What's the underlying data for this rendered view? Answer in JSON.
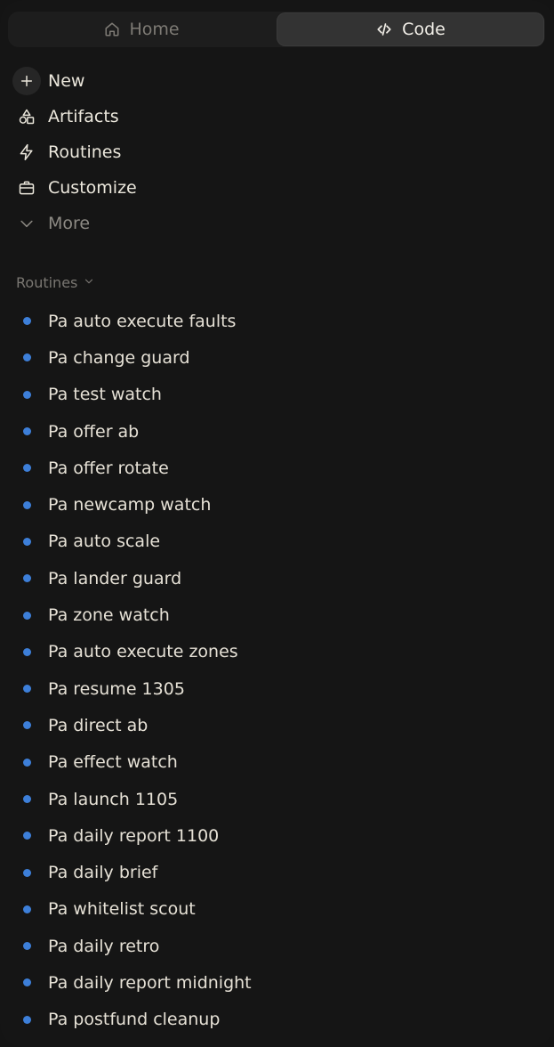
{
  "tabs": [
    {
      "label": "Home",
      "icon": "home-icon",
      "active": false
    },
    {
      "label": "Code",
      "icon": "code-icon",
      "active": true
    }
  ],
  "nav": [
    {
      "label": "New",
      "icon": "plus-icon"
    },
    {
      "label": "Artifacts",
      "icon": "shapes-icon"
    },
    {
      "label": "Routines",
      "icon": "lightning-icon"
    },
    {
      "label": "Customize",
      "icon": "briefcase-icon"
    },
    {
      "label": "More",
      "icon": "chevron-down-icon"
    }
  ],
  "routines_section": {
    "title": "Routines",
    "accent_color": "#3d7fd9",
    "items": [
      "Pa auto execute faults",
      "Pa change guard",
      "Pa test watch",
      "Pa offer ab",
      "Pa offer rotate",
      "Pa newcamp watch",
      "Pa auto scale",
      "Pa lander guard",
      "Pa zone watch",
      "Pa auto execute zones",
      "Pa resume 1305",
      "Pa direct ab",
      "Pa effect watch",
      "Pa launch 1105",
      "Pa daily report 1100",
      "Pa daily brief",
      "Pa whitelist scout",
      "Pa daily retro",
      "Pa daily report midnight",
      "Pa postfund cleanup"
    ]
  }
}
